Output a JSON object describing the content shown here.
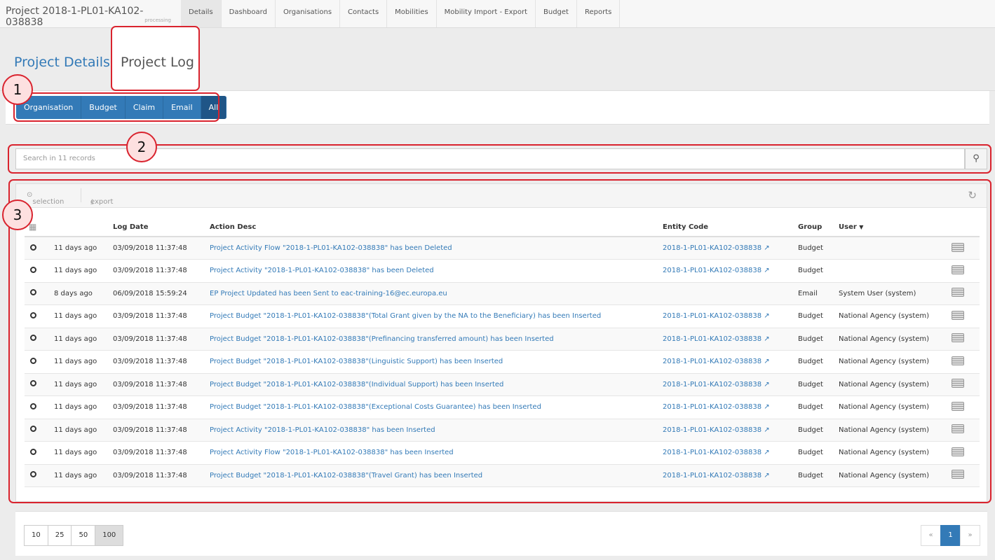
{
  "header": {
    "title": "Project 2018-1-PL01-KA102-038838",
    "status": "processing",
    "nav": [
      "Details",
      "Dashboard",
      "Organisations",
      "Contacts",
      "Mobilities",
      "Mobility Import - Export",
      "Budget",
      "Reports"
    ]
  },
  "tabs": {
    "details": "Project Details",
    "log": "Project Log"
  },
  "filters": [
    "Organisation",
    "Budget",
    "Claim",
    "Email",
    "All"
  ],
  "search": {
    "placeholder": "Search in 11 records"
  },
  "toolbar": {
    "selection": "selection",
    "export": "export"
  },
  "columns": {
    "log_date": "Log Date",
    "action_desc": "Action Desc",
    "entity_code": "Entity Code",
    "group": "Group",
    "user": "User"
  },
  "rows": [
    {
      "ago": "11 days ago",
      "date": "03/09/2018 11:37:48",
      "desc": "Project Activity Flow \"2018-1-PL01-KA102-038838\" has been Deleted",
      "entity": "2018-1-PL01-KA102-038838",
      "group": "Budget",
      "user": ""
    },
    {
      "ago": "11 days ago",
      "date": "03/09/2018 11:37:48",
      "desc": "Project Activity \"2018-1-PL01-KA102-038838\" has been Deleted",
      "entity": "2018-1-PL01-KA102-038838",
      "group": "Budget",
      "user": ""
    },
    {
      "ago": "8 days ago",
      "date": "06/09/2018 15:59:24",
      "desc": "EP Project Updated has been Sent to eac-training-16@ec.europa.eu",
      "entity": "",
      "group": "Email",
      "user": "System User (system)"
    },
    {
      "ago": "11 days ago",
      "date": "03/09/2018 11:37:48",
      "desc": "Project Budget \"2018-1-PL01-KA102-038838\"(Total Grant given by the NA to the Beneficiary) has been Inserted",
      "entity": "2018-1-PL01-KA102-038838",
      "group": "Budget",
      "user": "National Agency (system)"
    },
    {
      "ago": "11 days ago",
      "date": "03/09/2018 11:37:48",
      "desc": "Project Budget \"2018-1-PL01-KA102-038838\"(Prefinancing transferred amount) has been Inserted",
      "entity": "2018-1-PL01-KA102-038838",
      "group": "Budget",
      "user": "National Agency (system)"
    },
    {
      "ago": "11 days ago",
      "date": "03/09/2018 11:37:48",
      "desc": "Project Budget \"2018-1-PL01-KA102-038838\"(Linguistic Support) has been Inserted",
      "entity": "2018-1-PL01-KA102-038838",
      "group": "Budget",
      "user": "National Agency (system)"
    },
    {
      "ago": "11 days ago",
      "date": "03/09/2018 11:37:48",
      "desc": "Project Budget \"2018-1-PL01-KA102-038838\"(Individual Support) has been Inserted",
      "entity": "2018-1-PL01-KA102-038838",
      "group": "Budget",
      "user": "National Agency (system)"
    },
    {
      "ago": "11 days ago",
      "date": "03/09/2018 11:37:48",
      "desc": "Project Budget \"2018-1-PL01-KA102-038838\"(Exceptional Costs Guarantee) has been Inserted",
      "entity": "2018-1-PL01-KA102-038838",
      "group": "Budget",
      "user": "National Agency (system)"
    },
    {
      "ago": "11 days ago",
      "date": "03/09/2018 11:37:48",
      "desc": "Project Activity \"2018-1-PL01-KA102-038838\" has been Inserted",
      "entity": "2018-1-PL01-KA102-038838",
      "group": "Budget",
      "user": "National Agency (system)"
    },
    {
      "ago": "11 days ago",
      "date": "03/09/2018 11:37:48",
      "desc": "Project Activity Flow \"2018-1-PL01-KA102-038838\" has been Inserted",
      "entity": "2018-1-PL01-KA102-038838",
      "group": "Budget",
      "user": "National Agency (system)"
    },
    {
      "ago": "11 days ago",
      "date": "03/09/2018 11:37:48",
      "desc": "Project Budget \"2018-1-PL01-KA102-038838\"(Travel Grant) has been Inserted",
      "entity": "2018-1-PL01-KA102-038838",
      "group": "Budget",
      "user": "National Agency (system)"
    }
  ],
  "page_sizes": [
    "10",
    "25",
    "50",
    "100"
  ],
  "pagination": {
    "prev": "«",
    "current": "1",
    "next": "»"
  },
  "annotations": [
    "1",
    "2",
    "3"
  ],
  "colors": {
    "primary": "#337ab7",
    "annotation": "#d9232e"
  }
}
